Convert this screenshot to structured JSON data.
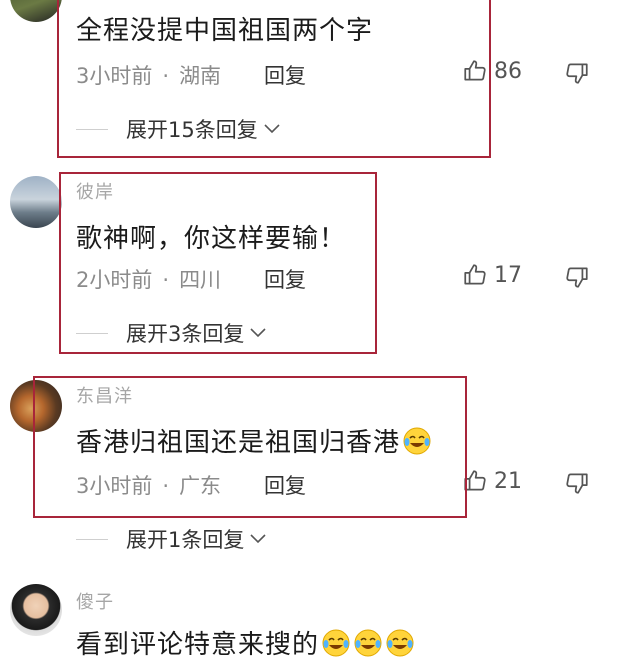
{
  "comments": [
    {
      "username": "",
      "text": "全程没提中国祖国两个字",
      "time": "3小时前",
      "location": "湖南",
      "reply_label": "回复",
      "likes": "86",
      "expand_label": "展开15条回复"
    },
    {
      "username": "彼岸",
      "text": "歌神啊，你这样要输！",
      "time": "2小时前",
      "location": "四川",
      "reply_label": "回复",
      "likes": "17",
      "expand_label": "展开3条回复"
    },
    {
      "username": "东昌洋",
      "text": "香港归祖国还是祖国归香港",
      "time": "3小时前",
      "location": "广东",
      "reply_label": "回复",
      "likes": "21",
      "expand_label": "展开1条回复"
    },
    {
      "username": "傻子",
      "text": "看到评论特意来搜的"
    }
  ],
  "separator": "·",
  "highlight_color": "#a8253a",
  "icons": {
    "like": "thumbs-up-icon",
    "dislike": "thumbs-down-icon",
    "expand": "chevron-down-icon",
    "emoji": "laughing-crying-emoji-icon"
  }
}
